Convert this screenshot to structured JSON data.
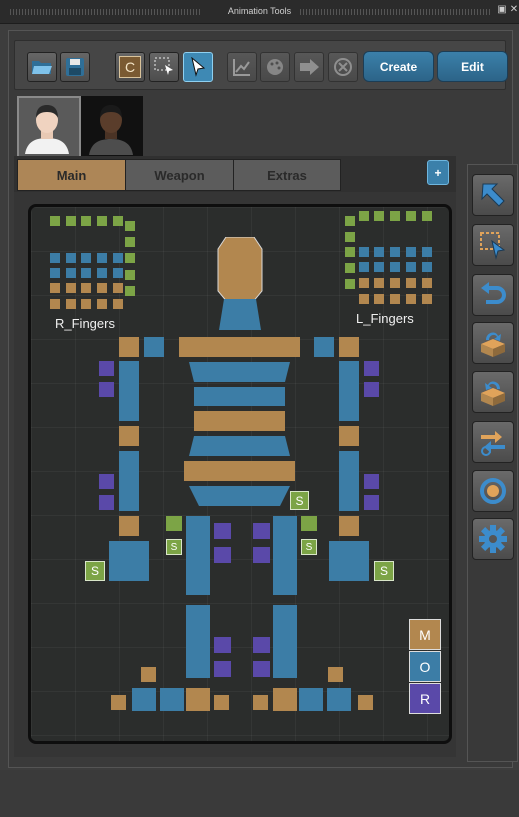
{
  "window": {
    "title": "Animation Tools"
  },
  "toolbar": {
    "buttons": [
      {
        "name": "open-folder-button",
        "icon": "folder-open-icon"
      },
      {
        "name": "save-button",
        "icon": "floppy-disk-icon"
      },
      {
        "name": "character-button",
        "icon": "c-letter-icon",
        "text": "C"
      },
      {
        "name": "rect-select-button",
        "icon": "rect-select-icon"
      },
      {
        "name": "pointer-select-button",
        "icon": "cursor-arrow-icon",
        "selected": true
      },
      {
        "name": "graph-button",
        "icon": "graph-icon",
        "disabled": true
      },
      {
        "name": "palette-button",
        "icon": "palette-icon",
        "disabled": true
      },
      {
        "name": "forward-button",
        "icon": "arrow-right-icon",
        "disabled": true
      },
      {
        "name": "cancel-button",
        "icon": "cancel-circle-icon",
        "disabled": true
      }
    ],
    "create_label": "Create",
    "edit_label": "Edit"
  },
  "characters": [
    {
      "name": "avatar-light",
      "selected": true
    },
    {
      "name": "avatar-dark",
      "selected": false
    }
  ],
  "tabs": [
    {
      "label": "Main",
      "active": true
    },
    {
      "label": "Weapon",
      "active": false
    },
    {
      "label": "Extras",
      "active": false
    }
  ],
  "add_tab_label": "+",
  "picker": {
    "right_fingers_label": "R_Fingers",
    "left_fingers_label": "L_Fingers",
    "s_label": "S"
  },
  "mor": [
    "M",
    "O",
    "R"
  ],
  "colors": {
    "accent_blue": "#3c7da6",
    "control_orange": "#b2874f",
    "ik_purple": "#5a49a9",
    "switch_green": "#7ca446"
  },
  "right_toolbar": [
    {
      "name": "select-arrow-button",
      "icon": "arrow-up-left-icon"
    },
    {
      "name": "box-select-button",
      "icon": "dashed-box-select-icon"
    },
    {
      "name": "undo-button",
      "icon": "undo-icon"
    },
    {
      "name": "box-in-button",
      "icon": "box-arrow-in-icon"
    },
    {
      "name": "box-out-button",
      "icon": "box-arrow-out-icon"
    },
    {
      "name": "swap-button",
      "icon": "swap-arrows-icon"
    },
    {
      "name": "reset-button",
      "icon": "ring-reset-icon"
    },
    {
      "name": "settings-button",
      "icon": "gear-icon"
    }
  ]
}
